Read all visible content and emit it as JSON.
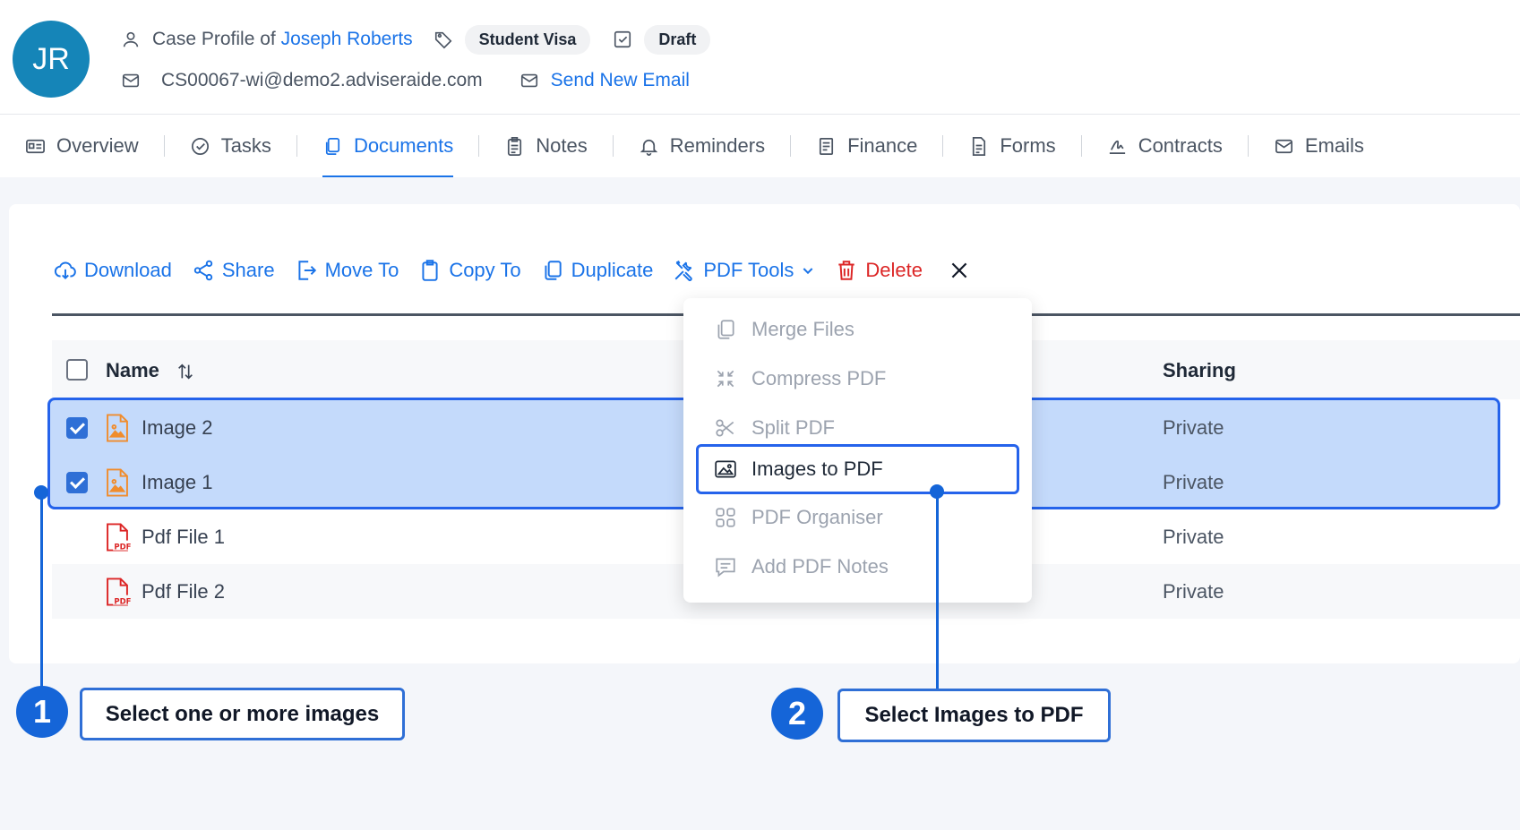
{
  "header": {
    "avatar_initials": "JR",
    "case_profile_prefix": "Case Profile of",
    "client_name": "Joseph Roberts",
    "visa_tag": "Student Visa",
    "status_tag": "Draft",
    "email": "CS00067-wi@demo2.adviseraide.com",
    "send_email_label": "Send New Email"
  },
  "tabs": [
    {
      "label": "Overview",
      "icon": "id-card-icon"
    },
    {
      "label": "Tasks",
      "icon": "check-circle-icon"
    },
    {
      "label": "Documents",
      "icon": "copy-icon",
      "active": true
    },
    {
      "label": "Notes",
      "icon": "clipboard-icon"
    },
    {
      "label": "Reminders",
      "icon": "bell-icon"
    },
    {
      "label": "Finance",
      "icon": "receipt-icon"
    },
    {
      "label": "Forms",
      "icon": "file-text-icon"
    },
    {
      "label": "Contracts",
      "icon": "signature-icon"
    },
    {
      "label": "Emails",
      "icon": "mail-icon"
    }
  ],
  "toolbar": {
    "download": "Download",
    "share": "Share",
    "move_to": "Move To",
    "copy_to": "Copy To",
    "duplicate": "Duplicate",
    "pdf_tools": "PDF Tools",
    "delete": "Delete"
  },
  "table": {
    "columns": {
      "name": "Name",
      "sharing": "Sharing"
    },
    "rows": [
      {
        "name": "Image 2",
        "sharing": "Private",
        "type": "image",
        "checked": true
      },
      {
        "name": "Image 1",
        "sharing": "Private",
        "type": "image",
        "checked": true
      },
      {
        "name": "Pdf File 1",
        "sharing": "Private",
        "type": "pdf",
        "checked": false
      },
      {
        "name": "Pdf File 2",
        "sharing": "Private",
        "type": "pdf",
        "checked": false
      }
    ]
  },
  "pdf_menu": [
    {
      "label": "Merge Files",
      "icon": "merge-files-icon"
    },
    {
      "label": "Compress PDF",
      "icon": "compress-icon"
    },
    {
      "label": "Split PDF",
      "icon": "scissors-icon"
    },
    {
      "label": "Images to PDF",
      "icon": "image-icon",
      "active": true
    },
    {
      "label": "PDF Organiser",
      "icon": "grid-icon"
    },
    {
      "label": "Add PDF Notes",
      "icon": "comment-icon"
    }
  ],
  "callouts": [
    {
      "number": "1",
      "text": "Select one or more images"
    },
    {
      "number": "2",
      "text": "Select Images to PDF"
    }
  ],
  "colors": {
    "accent": "#1a73e8",
    "delete": "#dc2626",
    "selection": "#c4dafb",
    "callout": "#1565d8"
  }
}
